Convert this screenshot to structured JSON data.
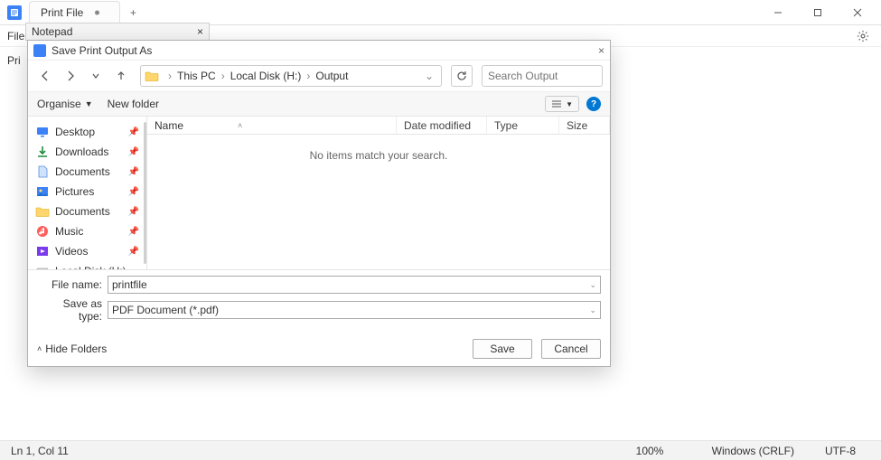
{
  "app": {
    "tab_title": "Print File",
    "menu_file": "File",
    "body_hint": "Pri",
    "status_pos": "Ln 1, Col 11",
    "status_zoom": "100%",
    "status_eol": "Windows (CRLF)",
    "status_enc": "UTF-8"
  },
  "notepad_stub": {
    "label": "Notepad"
  },
  "dialog": {
    "title": "Save Print Output As",
    "breadcrumb": [
      "This PC",
      "Local Disk (H:)",
      "Output"
    ],
    "search_placeholder": "Search Output",
    "toolbar": {
      "organise": "Organise",
      "new_folder": "New folder"
    },
    "sidebar": [
      {
        "label": "Desktop",
        "icon": "desktop",
        "pin": true
      },
      {
        "label": "Downloads",
        "icon": "download",
        "pin": true
      },
      {
        "label": "Documents",
        "icon": "doc-blue",
        "pin": true
      },
      {
        "label": "Pictures",
        "icon": "pictures",
        "pin": true
      },
      {
        "label": "Documents",
        "icon": "folder",
        "pin": true
      },
      {
        "label": "Music",
        "icon": "music",
        "pin": true
      },
      {
        "label": "Videos",
        "icon": "video",
        "pin": true
      },
      {
        "label": "Local Disk (H:)",
        "icon": "disk",
        "pin": false
      }
    ],
    "columns": {
      "name": "Name",
      "date": "Date modified",
      "type": "Type",
      "size": "Size"
    },
    "empty_msg": "No items match your search.",
    "filename_label": "File name:",
    "filename_value": "printfile",
    "savetype_label": "Save as type:",
    "savetype_value": "PDF Document (*.pdf)",
    "hide_folders": "Hide Folders",
    "save_btn": "Save",
    "cancel_btn": "Cancel"
  }
}
